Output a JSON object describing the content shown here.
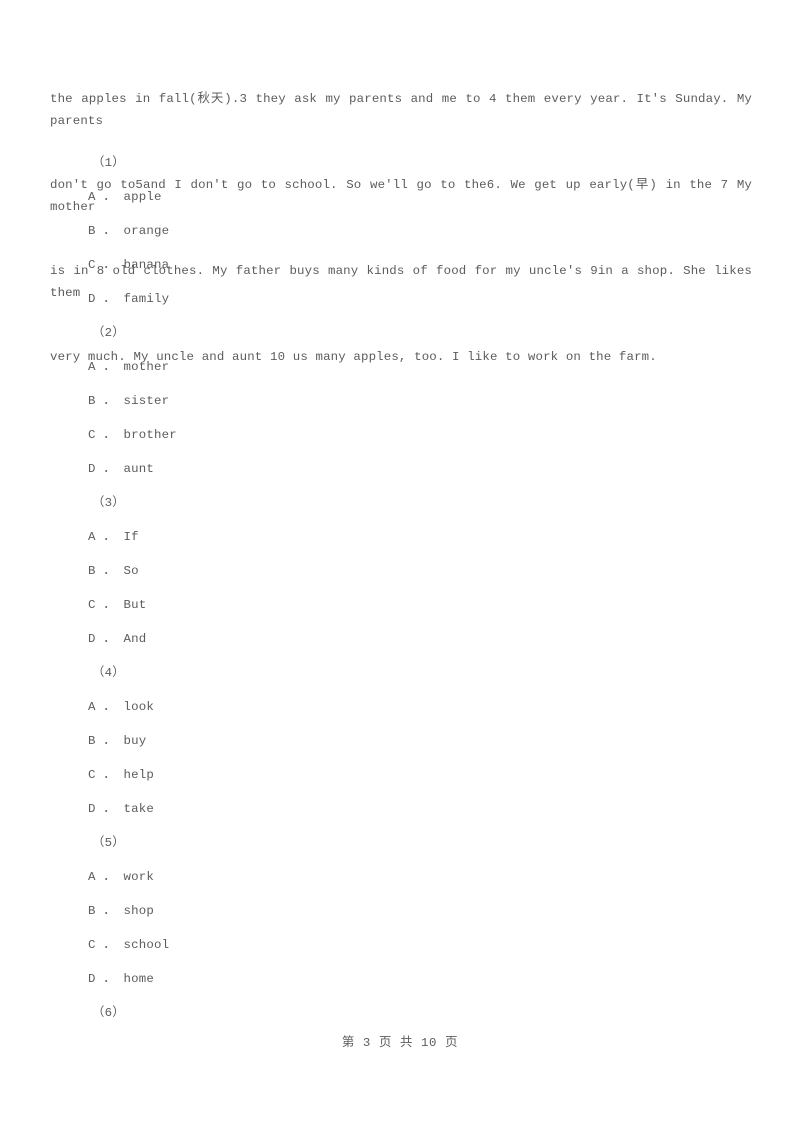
{
  "document": {
    "type": "exam-paper",
    "text_color": "#5c5c5c",
    "background_color": "#ffffff"
  },
  "passage": {
    "lines": [
      "the apples in fall(秋天).3 they ask my parents and me to 4 them every year. It's Sunday. My parents",
      "don't go to5and I don't go to school. So we'll go to the6. We get up early(早) in the 7 My mother",
      "is in 8 old clothes. My father buys many kinds of food for my uncle's 9in a shop. She likes them",
      "very much. My uncle and aunt 10 us many apples, too. I like to work on the farm."
    ],
    "full_text": "the apples in fall(秋天).3 they ask my parents and me to 4 them every year. It's Sunday. My parents don't go to5and I don't go to school. So we'll go to the6. We get up early(早) in the 7 My mother is in 8 old clothes. My father buys many kinds of food for my uncle's 9in a shop. She likes them very much. My uncle and aunt 10 us many apples, too. I like to work on the farm."
  },
  "questions": [
    {
      "number": "（1）",
      "options": [
        "A ． apple",
        "B ． orange",
        "C ． banana",
        "D ． family"
      ]
    },
    {
      "number": "（2）",
      "options": [
        "A ． mother",
        "B ． sister",
        "C ． brother",
        "D ． aunt"
      ]
    },
    {
      "number": "（3）",
      "options": [
        "A ． If",
        "B ． So",
        "C ． But",
        "D ． And"
      ]
    },
    {
      "number": "（4）",
      "options": [
        "A ． look",
        "B ． buy",
        "C ． help",
        "D ． take"
      ]
    },
    {
      "number": "（5）",
      "options": [
        "A ． work",
        "B ． shop",
        "C ． school",
        "D ． home"
      ]
    },
    {
      "number": "（6）",
      "options": []
    }
  ],
  "footer": {
    "page_label": "第 3 页 共 10 页",
    "current_page": "3",
    "total_pages": "10"
  }
}
